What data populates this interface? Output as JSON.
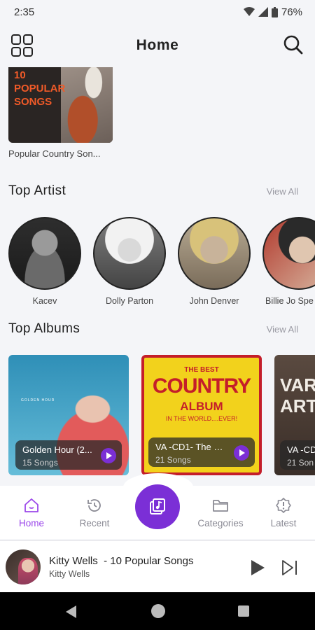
{
  "status_bar": {
    "time": "2:35",
    "battery": "76%"
  },
  "header": {
    "title": "Home"
  },
  "featured_playlist": {
    "art_title": "10 POPULAR SONGS",
    "caption": "Popular Country Son..."
  },
  "top_artist": {
    "title": "Top Artist",
    "view_all": "View All",
    "artists": [
      {
        "name": "Kacev"
      },
      {
        "name": "Dolly Parton"
      },
      {
        "name": "John Denver"
      },
      {
        "name": "Billie Jo Spe"
      }
    ]
  },
  "top_albums": {
    "title": "Top Albums",
    "view_all": "View All",
    "albums": [
      {
        "name": "Golden Hour (2...",
        "count": "15 Songs",
        "art_text": "GOLDEN HOUR"
      },
      {
        "name": "VA -CD1- The B...",
        "count": "21 Songs",
        "art_top": "THE BEST",
        "art_main": "COUNTRY",
        "art_sub": "ALBUM",
        "art_tag": "IN THE WORLD....EVER!"
      },
      {
        "name": "VA -CD",
        "count": "21 Son",
        "art_main": "VAR ART"
      }
    ]
  },
  "bottom_nav": {
    "items": [
      {
        "label": "Home",
        "active": true
      },
      {
        "label": "Recent",
        "active": false
      },
      {
        "label": "Categories",
        "active": false
      },
      {
        "label": "Latest",
        "active": false
      }
    ]
  },
  "now_playing": {
    "title": "Kitty Wells  - 10 Popular Songs",
    "artist": "Kitty Wells"
  },
  "colors": {
    "accent": "#7b2fd6",
    "accent_light": "#9b47ea",
    "background": "#f4f5f8"
  }
}
